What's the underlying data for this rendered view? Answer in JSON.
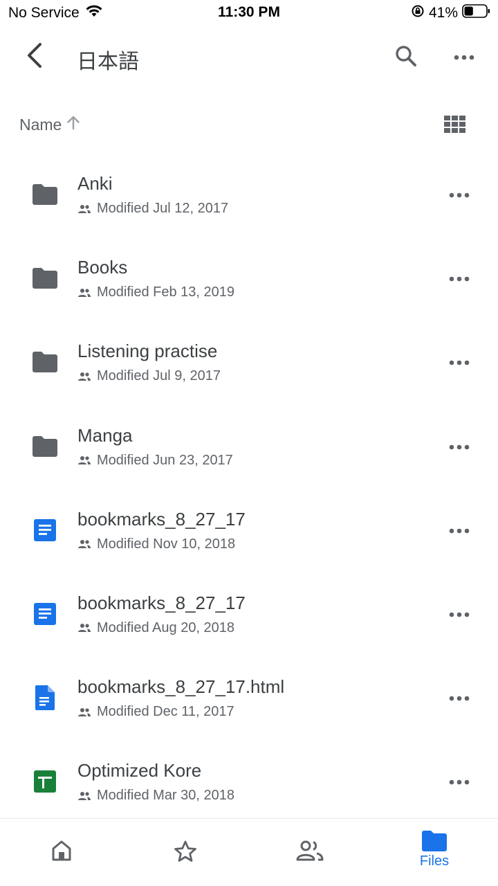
{
  "status_bar": {
    "carrier": "No Service",
    "time": "11:30 PM",
    "battery_percent": "41%",
    "battery_level": 0.41
  },
  "header": {
    "title": "日本語",
    "back_icon": "chevron-left-icon",
    "search_icon": "search-icon",
    "more_icon": "more-horizontal-icon"
  },
  "sort": {
    "label": "Name",
    "direction_icon": "arrow-up-icon",
    "view_toggle_icon": "grid-view-icon"
  },
  "files": [
    {
      "name": "Anki",
      "modified": "Modified Jul 12, 2017",
      "type": "folder"
    },
    {
      "name": "Books",
      "modified": "Modified Feb 13, 2019",
      "type": "folder"
    },
    {
      "name": "Listening practise",
      "modified": "Modified Jul 9, 2017",
      "type": "folder"
    },
    {
      "name": "Manga",
      "modified": "Modified Jun 23, 2017",
      "type": "folder"
    },
    {
      "name": "bookmarks_8_27_17",
      "modified": "Modified Nov 10, 2018",
      "type": "doc"
    },
    {
      "name": "bookmarks_8_27_17",
      "modified": "Modified Aug 20, 2018",
      "type": "doc"
    },
    {
      "name": "bookmarks_8_27_17.html",
      "modified": "Modified Dec 11, 2017",
      "type": "html"
    },
    {
      "name": "Optimized Kore",
      "modified": "Modified Mar 30, 2018",
      "type": "sheet"
    }
  ],
  "bottom_nav": {
    "items": [
      {
        "icon": "home-icon"
      },
      {
        "icon": "star-icon"
      },
      {
        "icon": "shared-people-icon"
      },
      {
        "icon": "folder-icon",
        "label": "Files",
        "active": true
      }
    ]
  },
  "colors": {
    "accent": "#1a73e8",
    "folder": "#5f6368",
    "doc": "#1a73e8",
    "sheet": "#188038",
    "text_primary": "#3c4043",
    "text_secondary": "#5f6368"
  }
}
